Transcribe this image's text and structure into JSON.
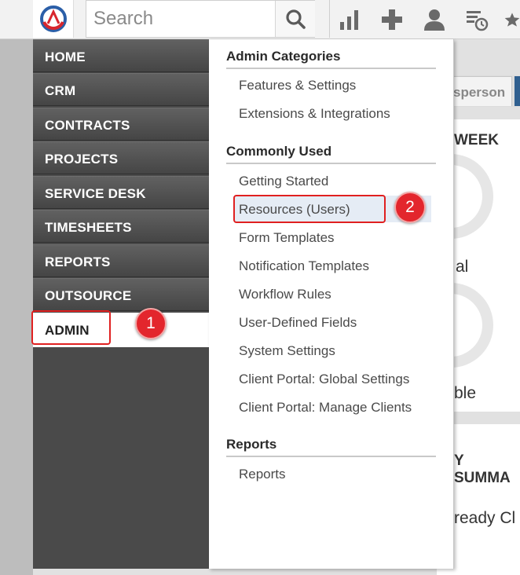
{
  "search": {
    "placeholder": "Search"
  },
  "toolbar_icons": [
    "bar-chart-icon",
    "plus-icon",
    "user-icon",
    "list-clock-icon",
    "star-icon"
  ],
  "background": {
    "tab_label": "sperson",
    "text_week": "WEEK",
    "text_al": "al",
    "text_ble": "ble",
    "text_summary": "Y SUMMA",
    "text_ready": "ready Cl"
  },
  "nav": {
    "items": [
      "HOME",
      "CRM",
      "CONTRACTS",
      "PROJECTS",
      "SERVICE DESK",
      "TIMESHEETS",
      "REPORTS",
      "OUTSOURCE",
      "ADMIN"
    ],
    "active": "ADMIN"
  },
  "menu": {
    "sections": [
      {
        "title": "Admin Categories",
        "links": [
          "Features & Settings",
          "Extensions & Integrations"
        ]
      },
      {
        "title": "Commonly Used",
        "links": [
          "Getting Started",
          "Resources (Users)",
          "Form Templates",
          "Notification Templates",
          "Workflow Rules",
          "User-Defined Fields",
          "System Settings",
          "Client Portal: Global Settings",
          "Client Portal: Manage Clients"
        ]
      },
      {
        "title": "Reports",
        "links": [
          "Reports"
        ]
      }
    ],
    "highlighted_link": "Resources (Users)"
  },
  "callouts": [
    "1",
    "2"
  ],
  "colors": {
    "accent_red": "#e3262d",
    "nav_bg": "#4a4a4a",
    "highlight": "#e5ecf5"
  }
}
